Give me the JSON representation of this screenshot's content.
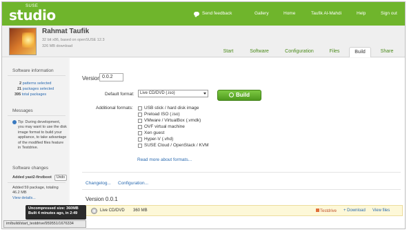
{
  "brand": {
    "top": "SUSE",
    "name": "studio"
  },
  "topnav": {
    "feedback": "Send feedback",
    "gallery": "Gallery",
    "home": "Home",
    "user": "Taufik Al-Mahdi",
    "help": "Help",
    "signout": "Sign out"
  },
  "appliance": {
    "name": "Rahmat Taufik",
    "base": "32 bit x86, based on openSUSE 12.3",
    "size": "326 MB download"
  },
  "tabs": [
    "Start",
    "Software",
    "Configuration",
    "Files",
    "Build",
    "Share"
  ],
  "active_tab": "Build",
  "sidebar": {
    "info_title": "Software information",
    "patterns_count": "2",
    "patterns_label": "patterns selected",
    "packages_count": "21",
    "packages_label": "packages selected",
    "total_count": "395",
    "total_label": "total packages",
    "messages_title": "Messages",
    "tip_lines": [
      "Tip: During development,",
      "you may want to use the disk",
      "image format to build your",
      "appliance, to take advantage",
      "of the modified files feature",
      "in Testdrive."
    ],
    "changes_title": "Software changes",
    "change_added": "Added yast2-firstboot",
    "undo": "Undo",
    "change_lines": [
      "Added 59 package, totaling",
      "46.2 MB"
    ],
    "view_details": "View details..."
  },
  "build": {
    "version_label": "Version",
    "version_value": "0.0.2",
    "default_format_label": "Default format:",
    "default_format_value": "Live CD/DVD (.iso)",
    "build_button": "Build",
    "additional_label": "Additional formats:",
    "formats": [
      "USB stick / hard disk image",
      "Preload ISO (.iso)",
      "VMware / VirtualBox (.vmdk)",
      "OVF virtual machine",
      "Xen guest",
      "Hyper-V (.vhd)",
      "SUSE Cloud / OpenStack / KVM"
    ],
    "more_link": "Read more about formats...",
    "changelog": "Changelog...",
    "configuration": "Configuration..."
  },
  "previous": {
    "version_label": "Version 0.0.1",
    "format": "Live CD/DVD",
    "size": "360 MB",
    "testdrive": "Testdrive",
    "download": "+ Download",
    "viewfiles": "View files"
  },
  "tooltip": {
    "line1": "Uncompressed size: 360MB",
    "line2": "Built 4 minutes ago, in 2:49"
  },
  "status_url": "im/build/start_testdrive/959551/1676334"
}
